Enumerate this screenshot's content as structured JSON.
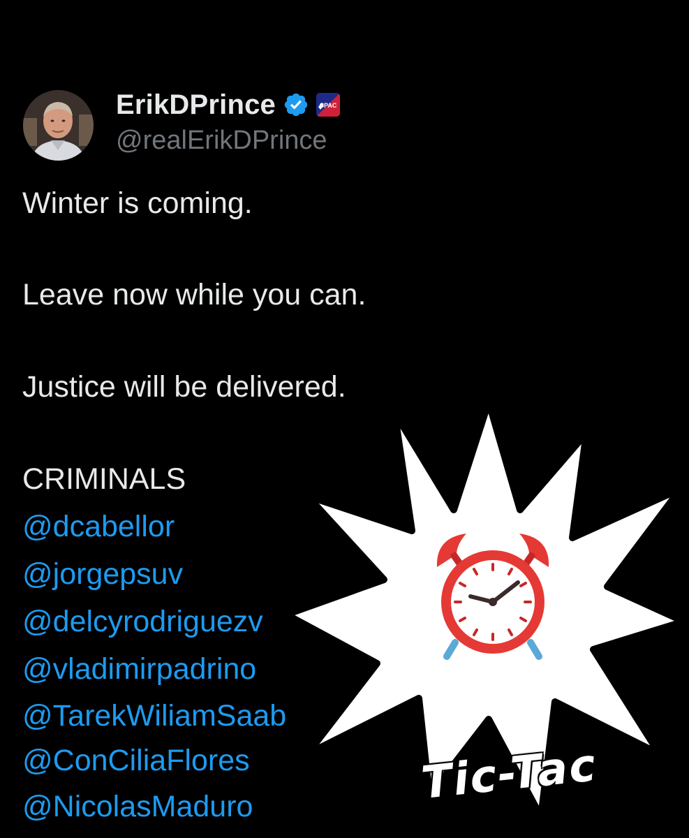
{
  "author": {
    "display_name": "ErikDPrince",
    "handle": "@realErikDPrince",
    "verified": true,
    "affiliation_badge": "CPAC",
    "avatar_icon": "profile-photo"
  },
  "tweet": {
    "lines": [
      "Winter is coming.",
      "Leave now while you can.",
      "Justice will be delivered.",
      "CRIMINALS"
    ],
    "mentions": [
      "@dcabellor",
      "@jorgepsuv",
      "@delcyrodriguezv",
      "@vladimirpadrino",
      "@TarekWiliamSaab",
      "@ConCiliaFlores",
      "@NicolasMaduro"
    ]
  },
  "sticker": {
    "caption": "Tic-Tac",
    "icon": "alarm-clock-icon",
    "shape": "starburst"
  },
  "colors": {
    "background": "#000000",
    "text": "#e7e9ea",
    "muted": "#71767b",
    "link": "#1d9bf0",
    "verified": "#1d9bf0",
    "clock_red": "#e53935"
  }
}
